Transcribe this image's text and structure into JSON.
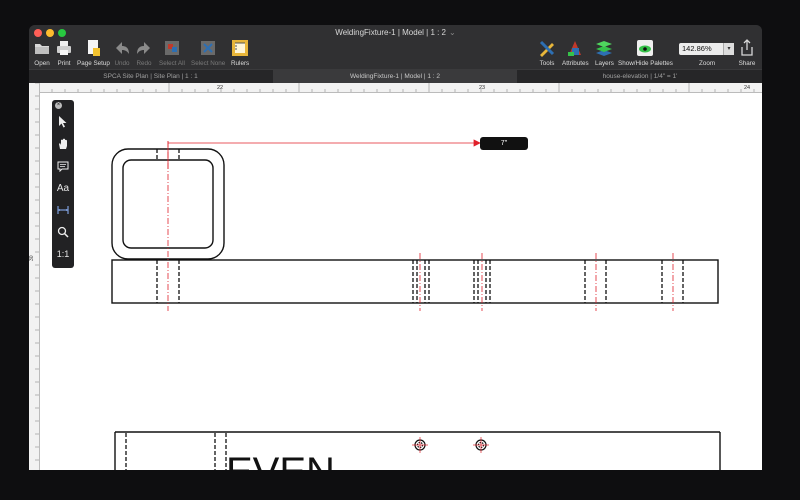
{
  "window": {
    "title": "WeldingFixture-1 | Model | 1 : 2"
  },
  "toolbar": {
    "open": "Open",
    "print": "Print",
    "page_setup": "Page Setup",
    "undo": "Undo",
    "redo": "Redo",
    "select_all": "Select All",
    "select_none": "Select None",
    "rulers": "Rulers",
    "tools": "Tools",
    "attributes": "Attributes",
    "layers": "Layers",
    "show_hide_palettes": "Show/Hide Palettes",
    "zoom_value": "142.86%",
    "zoom_label": "Zoom",
    "share": "Share"
  },
  "tabs": [
    {
      "label": "SPCA Site Plan | Site Plan | 1 : 1",
      "active": false
    },
    {
      "label": "WeldingFixture-1 | Model | 1 : 2",
      "active": true
    },
    {
      "label": "house-elevation | 1/4\" = 1'",
      "active": false
    }
  ],
  "ruler": {
    "top_marks": [
      "22",
      "23",
      "24"
    ],
    "left_marks": [
      "30"
    ]
  },
  "palette": {
    "ratio": "1:1",
    "text": "Aa"
  },
  "drawing": {
    "dimension": "7\"",
    "label_text": "EVEN"
  },
  "colors": {
    "centerline": "#e0202a",
    "stroke": "#111111",
    "accent_green": "#36c24a"
  }
}
